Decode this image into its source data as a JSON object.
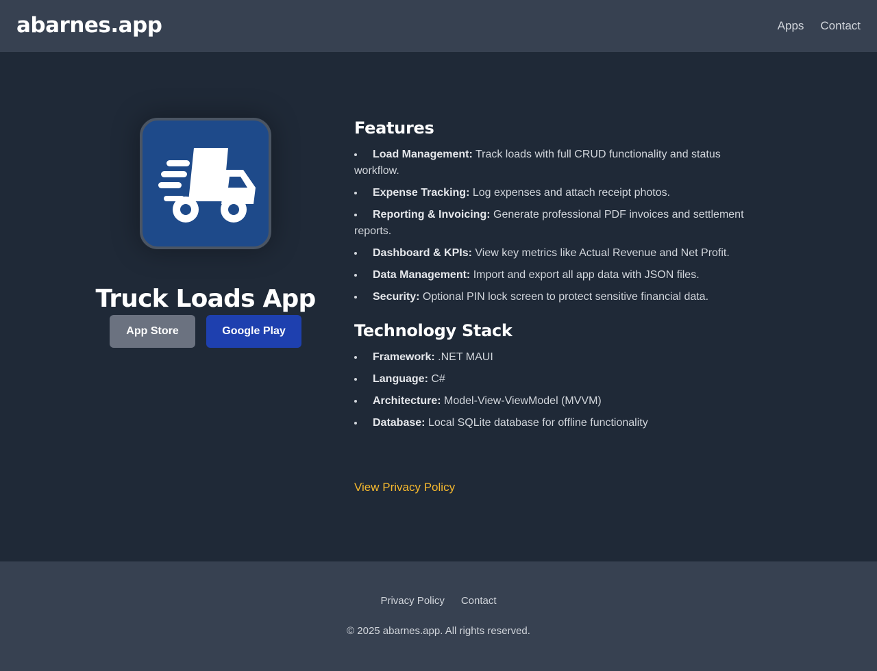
{
  "header": {
    "brand": "abarnes.app",
    "nav": [
      {
        "label": "Apps"
      },
      {
        "label": "Contact"
      }
    ]
  },
  "app": {
    "icon": "truck-fast-icon",
    "title": "Truck Loads App",
    "buttons": {
      "app_store": "App Store",
      "google_play": "Google Play"
    }
  },
  "features": {
    "title": "Features",
    "items": [
      {
        "label": "Load Management:",
        "text": "Track loads with full CRUD functionality and status workflow."
      },
      {
        "label": "Expense Tracking:",
        "text": "Log expenses and attach receipt photos."
      },
      {
        "label": "Reporting & Invoicing:",
        "text": "Generate professional PDF invoices and settlement reports."
      },
      {
        "label": "Dashboard & KPIs:",
        "text": "View key metrics like Actual Revenue and Net Profit."
      },
      {
        "label": "Data Management:",
        "text": "Import and export all app data with JSON files."
      },
      {
        "label": "Security:",
        "text": "Optional PIN lock screen to protect sensitive financial data."
      }
    ]
  },
  "tech": {
    "title": "Technology Stack",
    "items": [
      {
        "label": "Framework:",
        "text": ".NET MAUI"
      },
      {
        "label": "Language:",
        "text": "C#"
      },
      {
        "label": "Architecture:",
        "text": "Model-View-ViewModel (MVVM)"
      },
      {
        "label": "Database:",
        "text": "Local SQLite database for offline functionality"
      }
    ]
  },
  "privacy_link": "View Privacy Policy",
  "footer": {
    "nav": [
      {
        "label": "Privacy Policy"
      },
      {
        "label": "Contact"
      }
    ],
    "copyright": "© 2025 abarnes.app. All rights reserved."
  },
  "colors": {
    "header_bg": "#374151",
    "page_bg": "#1f2937",
    "link_accent": "#f5b82e",
    "google_play_btn": "#1e40af",
    "app_store_btn": "#6b7280",
    "icon_bg": "#1e4a8a"
  }
}
